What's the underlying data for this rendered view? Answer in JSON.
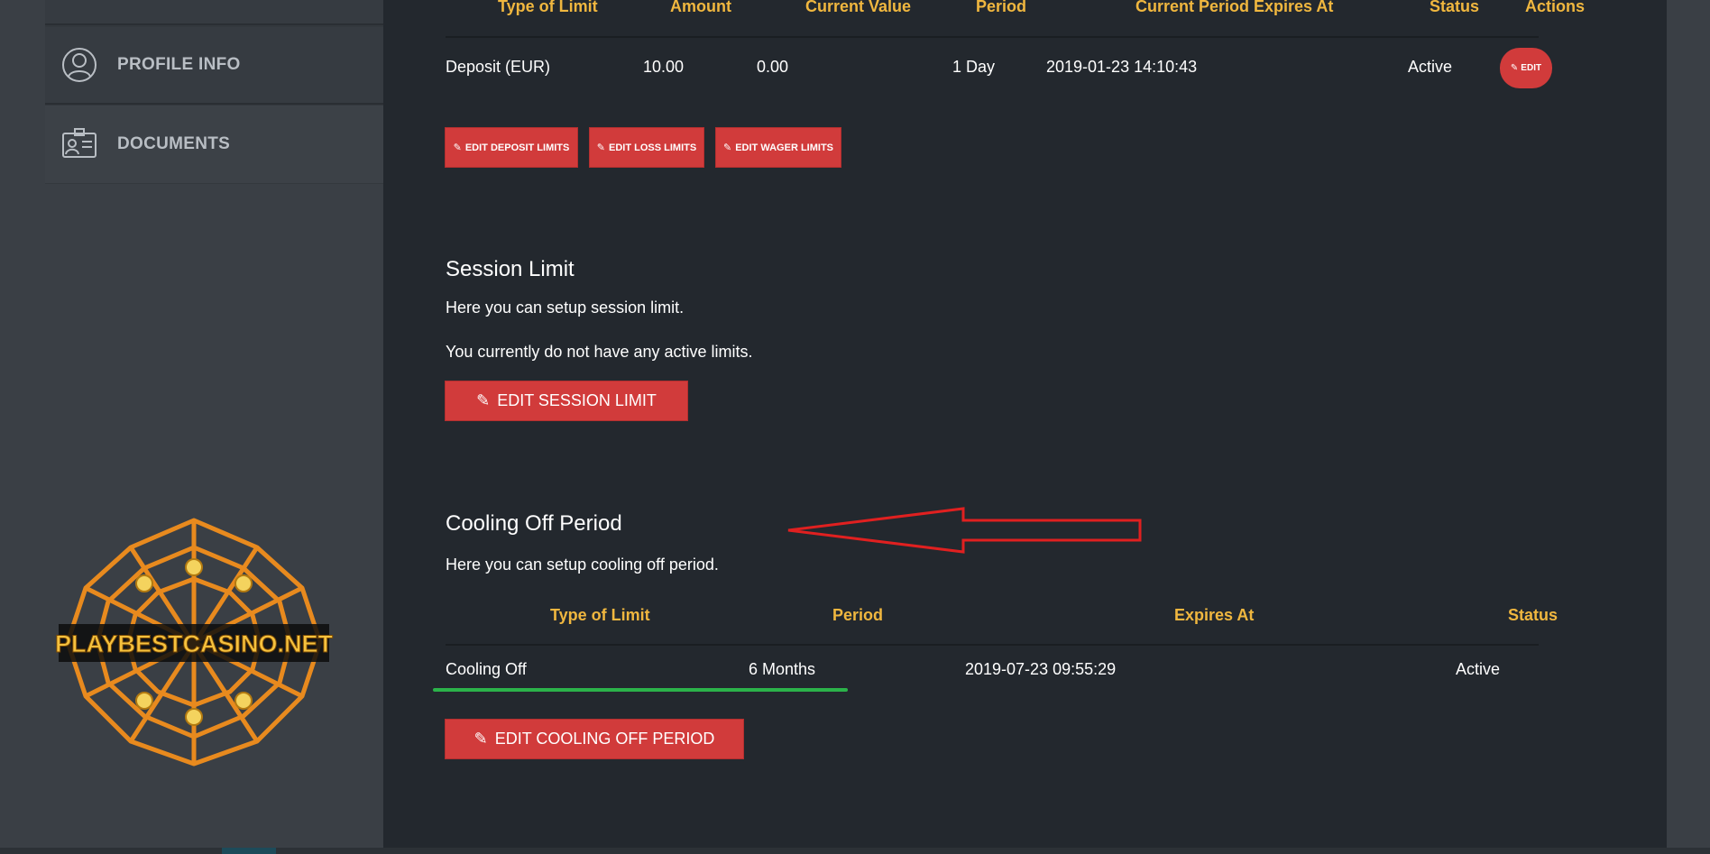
{
  "sidebar": {
    "items": [
      {
        "label": "PROFILE INFO",
        "icon": "user-icon"
      },
      {
        "label": "DOCUMENTS",
        "icon": "id-card-icon"
      }
    ]
  },
  "logo": {
    "text": "PLAYBESTCASINO.NET",
    "icon": "spider-web-logo"
  },
  "limits_table": {
    "headers": [
      "Type of Limit",
      "Amount",
      "Current Value",
      "Period",
      "Current Period Expires At",
      "Status",
      "Actions"
    ],
    "rows": [
      {
        "type": "Deposit (EUR)",
        "amount": "10.00",
        "current_value": "0.00",
        "period": "1 Day",
        "expires": "2019-01-23 14:10:43",
        "status": "Active",
        "action": "EDIT"
      }
    ]
  },
  "limit_buttons": [
    "EDIT DEPOSIT LIMITS",
    "EDIT LOSS LIMITS",
    "EDIT WAGER LIMITS"
  ],
  "session": {
    "title": "Session Limit",
    "description": "Here you can setup session limit.",
    "status_text": "You currently do not have any active limits.",
    "button": "EDIT SESSION LIMIT"
  },
  "cooling": {
    "title": "Cooling Off Period",
    "description": "Here you can setup cooling off period.",
    "headers": [
      "Type of Limit",
      "Period",
      "Expires At",
      "Status"
    ],
    "row": {
      "type": "Cooling Off",
      "period": "6 Months",
      "expires": "2019-07-23 09:55:29",
      "status": "Active"
    },
    "button": "EDIT COOLING OFF PERIOD"
  },
  "colors": {
    "accent_red": "#d13b3b",
    "header_gold": "#f0b73f",
    "highlight_green": "#2bb34a",
    "annotation_red": "#e02020"
  }
}
